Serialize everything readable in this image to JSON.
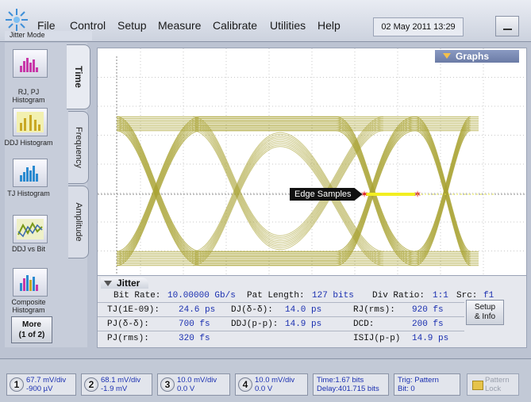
{
  "menubar": {
    "mode_label": "Jitter Mode",
    "menus": [
      "File",
      "Control",
      "Setup",
      "Measure",
      "Calibrate",
      "Utilities",
      "Help"
    ],
    "datetime": "02 May 2011   13:29"
  },
  "left_panel": {
    "tiles": [
      {
        "label": "RJ, PJ Histogram",
        "icon": "rj-pj-histogram-icon"
      },
      {
        "label": "DDJ Histogram",
        "icon": "ddj-histogram-icon"
      },
      {
        "label": "TJ Histogram",
        "icon": "tj-histogram-icon"
      },
      {
        "label": "DDJ vs Bit",
        "icon": "ddj-vs-bit-icon"
      },
      {
        "label": "Composite Histogram",
        "icon": "composite-histogram-icon"
      }
    ],
    "more": {
      "line1": "More",
      "line2": "(1 of 2)"
    },
    "tabs": [
      "Time",
      "Frequency",
      "Amplitude"
    ]
  },
  "graph": {
    "graphs_button": "Graphs",
    "edge_label": "Edge Samples",
    "trace_color": "#a9a232"
  },
  "jitter": {
    "header": "Jitter",
    "summary": {
      "bit_rate_label": "Bit Rate:",
      "bit_rate": "10.00000 Gb/s",
      "pat_length_label": "Pat Length:",
      "pat_length": "127 bits",
      "div_ratio_label": "Div Ratio:",
      "div_ratio": "1:1",
      "src_label": "Src:",
      "src": "f1"
    },
    "rows": [
      [
        {
          "k": "TJ(1E-09):",
          "v": "24.6 ps"
        },
        {
          "k": "DJ(δ-δ):",
          "v": "14.0 ps"
        },
        {
          "k": "RJ(rms):",
          "v": "920 fs"
        }
      ],
      [
        {
          "k": "PJ(δ-δ):",
          "v": "700 fs"
        },
        {
          "k": "DDJ(p-p):",
          "v": "14.9 ps"
        },
        {
          "k": "DCD:",
          "v": "200 fs"
        }
      ],
      [
        {
          "k": "PJ(rms):",
          "v": "320 fs"
        },
        {
          "k": "",
          "v": ""
        },
        {
          "k": "ISIJ(p-p)",
          "v": "14.9 ps"
        }
      ]
    ],
    "setup_info": {
      "line1": "Setup",
      "line2": "& Info"
    }
  },
  "statusbar": {
    "channels": [
      {
        "num": "1",
        "scale": "67.7 mV/div",
        "offset": "-900 µV"
      },
      {
        "num": "2",
        "scale": "68.1 mV/div",
        "offset": "-1.9 mV"
      },
      {
        "num": "3",
        "scale": "10.0 mV/div",
        "offset": "0.0 V"
      },
      {
        "num": "4",
        "scale": "10.0 mV/div",
        "offset": "0.0 V"
      }
    ],
    "time": {
      "line1": "Time:1.67 bits",
      "line2": "Delay:401.715 bits"
    },
    "trig": {
      "line1": "Trig: Pattern",
      "line2": "Bit: 0"
    },
    "pattern_lock": {
      "line1": "Pattern",
      "line2": "Lock"
    }
  }
}
